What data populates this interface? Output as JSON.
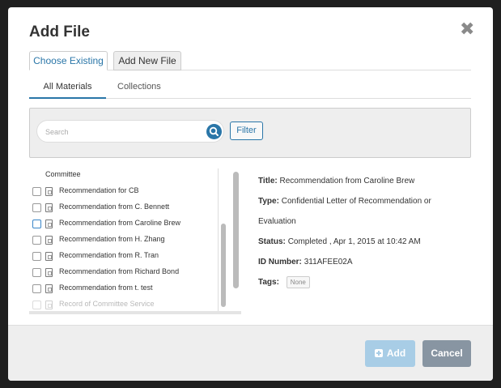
{
  "dialog": {
    "title": "Add File",
    "close_glyph": "✖"
  },
  "top_tabs": [
    {
      "label": "Choose Existing",
      "active": true
    },
    {
      "label": "Add New File",
      "active": false
    }
  ],
  "sub_tabs": [
    {
      "label": "All Materials",
      "active": true
    },
    {
      "label": "Collections",
      "active": false
    }
  ],
  "search": {
    "placeholder": "Search",
    "value": "",
    "icon": "search-icon"
  },
  "filter": {
    "label": "Filter"
  },
  "list": {
    "partial_label": "Committee",
    "items": [
      {
        "label": "Recommendation for CB",
        "checked": false
      },
      {
        "label": "Recommendation from C. Bennett",
        "checked": false
      },
      {
        "label": "Recommendation from Caroline Brew",
        "checked": false,
        "highlighted": true
      },
      {
        "label": "Recommendation from H. Zhang",
        "checked": false
      },
      {
        "label": "Recommendation from R. Tran",
        "checked": false
      },
      {
        "label": "Recommendation from Richard Bond",
        "checked": false
      },
      {
        "label": "Recommendation from t. test",
        "checked": false
      },
      {
        "label": "Record of Committee Service",
        "checked": false,
        "partial": true
      }
    ]
  },
  "details": {
    "title_label": "Title:",
    "title_value": "Recommendation from Caroline Brew",
    "type_label": "Type:",
    "type_value_line1": "Confidential Letter of Recommendation or",
    "type_value_line2": "Evaluation",
    "status_label": "Status:",
    "status_value": "Completed , Apr 1, 2015 at 10:42 AM",
    "id_label": "ID Number:",
    "id_value": "311AFEE02A",
    "tags_label": "Tags:",
    "tags_value": "None"
  },
  "footer": {
    "add_label": "Add",
    "cancel_label": "Cancel"
  },
  "colors": {
    "accent": "#2a76a8",
    "add_disabled": "#a8cde6",
    "cancel": "#8895a2"
  }
}
